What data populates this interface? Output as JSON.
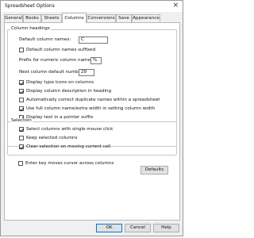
{
  "window": {
    "title": "Spreadsheet Options",
    "close_glyph": "×"
  },
  "tabs": [
    "General",
    "Books",
    "Sheets",
    "Columns",
    "Conversions",
    "Save",
    "Appearance"
  ],
  "active_tab": "Columns",
  "column_headings": {
    "label": "Column headings",
    "default_names_label": "Default column names:",
    "default_names_value": "C",
    "suffixed_label": "Default column names suffixed",
    "suffixed_checked": false,
    "prefix_label": "Prefix for numeric column names:",
    "prefix_value": "%",
    "next_number_label": "Next column default number:",
    "next_number_value": "29",
    "options": [
      {
        "label": "Display type icons on columns",
        "checked": true
      },
      {
        "label": "Display column description in heading",
        "checked": true
      },
      {
        "label": "Automatically correct duplicate names within a spreadsheet",
        "checked": false
      },
      {
        "label": "Use full column name/extra width in setting column width",
        "checked": true
      },
      {
        "label": "Display text in a pointer suffix",
        "checked": true
      }
    ]
  },
  "selection": {
    "label": "Selection",
    "options": [
      {
        "label": "Select columns with single mouse click",
        "checked": true
      },
      {
        "label": "Keep selected columns",
        "checked": false
      },
      {
        "label": "Clear selection on moving current cell",
        "checked": true
      }
    ]
  },
  "enter_key": {
    "label": "Enter key moves cursor across columns",
    "checked": false
  },
  "defaults_button": "Defaults",
  "footer": {
    "ok": "OK",
    "cancel": "Cancel",
    "help": "Help"
  },
  "colors": {
    "accent": "#0078d7",
    "panel": "#ffffff",
    "window_bg": "#f0f0f0"
  }
}
